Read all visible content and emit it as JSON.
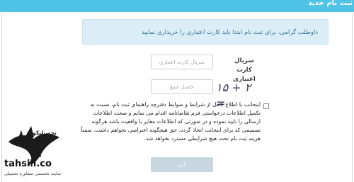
{
  "header": {
    "title": "ثبت نام جدید"
  },
  "notice": {
    "text": "داوطلب گرامی، برای ثبت نام ابتدا باید کارت اعتباری را خریداری نمایید"
  },
  "form": {
    "serial_label": "سریال کارت اعتباری",
    "serial_placeholder": "سریال کارت اعتباری",
    "captcha_image_text": "۱۵ + ۲ =",
    "captcha_placeholder": "حاصل جمع",
    "terms_text": "اینجانب با اطلاع کامل از شرایط و ضوابط دفترچه راهنمای ثبت نام، نسبت به تکمیل اطلاعات درخواستی فرم تقاضانامه اقدام می نمایم و صحت اطلاعات ارسالی را تایید نموده و در صورتی که اطلاعات مغایر با واقعیت باشد هرگونه تصمیمی که برای اینجانب اتخاذ گردد، حق هیچگونه اعتراضی نخواهم داشت. ضمناً هزینه ثبت نام تحت هیچ شرایطی مسترد نخواهد شد.",
    "submit_label": "تایید",
    "terms_checked": false
  },
  "watermark": {
    "title": "تحصیلیکو",
    "name": "tahsili.co",
    "tagline": "سایت تخصصی مشاوره تحصیلی"
  }
}
